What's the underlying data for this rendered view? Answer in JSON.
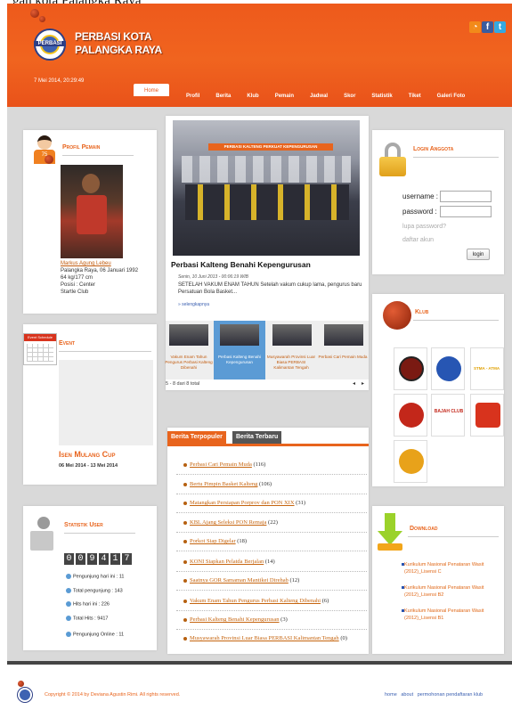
{
  "caption_fragment": "gan kota Palangka Raya",
  "header": {
    "site_name_line1": "PERBASI KOTA",
    "site_name_line2": "PALANGKA RAYA",
    "logo_label": "PERBASI",
    "datetime": "7 Mei 2014, 20:29:49",
    "social": [
      {
        "icon": "rss-icon",
        "glyph": "◔",
        "color": "#f28a1a"
      },
      {
        "icon": "facebook-icon",
        "glyph": "f",
        "color": "#3b5c9e"
      },
      {
        "icon": "twitter-icon",
        "glyph": "t",
        "color": "#35a9e0"
      }
    ]
  },
  "nav": [
    "Home",
    "Profil",
    "Berita",
    "Klub",
    "Pemain",
    "Jadwal",
    "Skor",
    "Statistik",
    "Tiket",
    "Galeri Foto"
  ],
  "profil_pemain": {
    "title": "Profil Pemain",
    "jersey_number": "75",
    "name": "Markus Agung Lebeu",
    "birth": "Palangka Raya, 06 Januari 1992",
    "body": "64 kg/177 cm",
    "position": "Posisi : Center",
    "club": "Startle Club"
  },
  "event": {
    "title": "Event",
    "calendar_label": "Event Schedule",
    "event_name": "Isen Mulang Cup",
    "event_date": "06 Mei 2014 - 13 Mei 2014"
  },
  "statistik": {
    "title": "Statistik User",
    "digits": [
      "0",
      "0",
      "9",
      "4",
      "1",
      "7"
    ],
    "rows": [
      {
        "label": "Pengunjung hari ini :",
        "value": "11"
      },
      {
        "label": "Total pengunjung :",
        "value": "143"
      },
      {
        "label": "Hits hari ini :",
        "value": "226"
      },
      {
        "label": "Total Hits :",
        "value": "9417"
      },
      {
        "label": "Pengunjung Online :",
        "value": "11"
      }
    ]
  },
  "headline": {
    "title": "Perbasi Kalteng Benahi Kepengurusan",
    "photo_banner": "PERBASI KALTENG PERKUAT KEPENGURUSAN",
    "meta": "Senin, 10 Juni 2013 - 00:06:19 WIB",
    "summary": "SETELAH VAKUM ENAM TAHUN Setelah vakum cukup lama, pengurus baru Persatuan Bola Basket...",
    "more": "» selengkapnya",
    "thumbs": [
      "Vakum Enam Tahun Pengurus Perbasi Kalteng Dibenahi",
      "Perbasi Kalteng Benahi Kepengurusan",
      "Musyawarah Provinsi Luar Biasa PERBASI Kalimantan Tengah",
      "Perbasi Cari Pemain Muda"
    ],
    "pager": "5 - 8 dari 8 total",
    "prev": "◂",
    "next": "▸"
  },
  "berita": {
    "tab_popular": "Berita Terpopuler",
    "tab_latest": "Berita Terbaru",
    "items": [
      {
        "title": "Perbasi Cari Pemain Muda",
        "count": "(116)"
      },
      {
        "title": "Bertu Pimpin Basket Kalteng",
        "count": "(106)"
      },
      {
        "title": "Matangkan Persiapan Porprov dan PON XIX",
        "count": "(31)"
      },
      {
        "title": "KBL Ajang Seleksi PON Remaja",
        "count": "(22)"
      },
      {
        "title": "Porkot Siap Digelar",
        "count": "(18)"
      },
      {
        "title": "KONI Siapkan Pelatda Berjalan",
        "count": "(14)"
      },
      {
        "title": "Saatnya GOR Samaman Mantikei Direhab",
        "count": "(12)"
      },
      {
        "title": "Vakum Enam Tahun Pengurus Perbasi Kalteng Dibenahi",
        "count": "(6)"
      },
      {
        "title": "Perbasi Kalteng Benahi Kepengurusan",
        "count": "(3)"
      },
      {
        "title": "Musyawarah Provinsi Luar Biasa PERBASI Kalimantan Tengah",
        "count": "(0)"
      }
    ]
  },
  "login": {
    "title": "Login Anggota",
    "username_label": "username :",
    "password_label": "password :",
    "forgot": "lupa password?",
    "register": "daftar akun",
    "button": "login"
  },
  "klub": {
    "title": "Klub",
    "logos": [
      {
        "icon": "club-logo-1",
        "color": "#7a1a12"
      },
      {
        "icon": "club-logo-2",
        "color": "#2756b3"
      },
      {
        "icon": "club-logo-stma-atma",
        "color": "#f2f2f2",
        "text": "STMA - ATMA"
      },
      {
        "icon": "club-logo-4",
        "color": "#c3271a"
      },
      {
        "icon": "club-logo-bajah-club",
        "color": "#ffffff",
        "text": "BAJAH CLUB"
      },
      {
        "icon": "club-logo-6",
        "color": "#d8331d"
      },
      {
        "icon": "club-logo-7",
        "color": "#e8a21a"
      }
    ]
  },
  "download": {
    "title": "Download",
    "items": [
      "Kurikulum Nasional Penataran Wasit (2012)_Lisensi C",
      "Kurikulum Nasional Penataran Wasit (2012)_Lisensi B2",
      "Kurikulum Nasional Penataran Wasit (2012)_Lisensi B1"
    ]
  },
  "footer": {
    "copyright": "Copyright © 2014 by Deviana Agustin Rimi. All rights reserved.",
    "links": [
      "home",
      "about",
      "permohonan pendaftaran klub"
    ]
  }
}
